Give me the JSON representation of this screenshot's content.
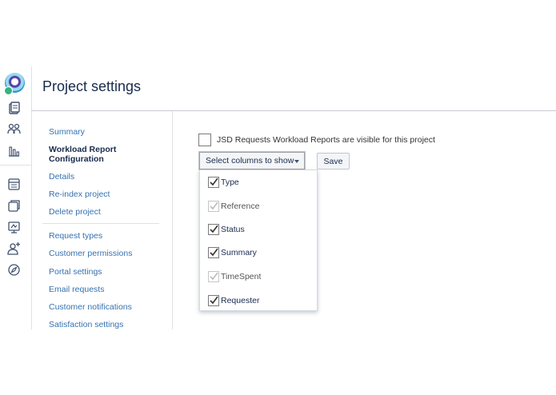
{
  "page": {
    "title": "Project settings"
  },
  "sidebar_nav": {
    "group1": [
      {
        "label": "Summary",
        "active": false
      },
      {
        "label": "Workload Report",
        "active": true
      },
      {
        "label": "Configuration",
        "active": true
      },
      {
        "label": "Details",
        "active": false
      },
      {
        "label": "Re-index project",
        "active": false
      },
      {
        "label": "Delete project",
        "active": false
      }
    ],
    "group2": [
      {
        "label": "Request types"
      },
      {
        "label": "Customer permissions"
      },
      {
        "label": "Portal settings"
      },
      {
        "label": "Email requests"
      },
      {
        "label": "Customer notifications"
      },
      {
        "label": "Satisfaction settings"
      }
    ]
  },
  "visibility": {
    "label": "JSD Requests Workload Reports are visible for this project",
    "checked": false
  },
  "controls": {
    "select_columns_label": "Select columns to show",
    "save_label": "Save"
  },
  "columns_menu": [
    {
      "label": "Type",
      "checked": true,
      "disabled": false
    },
    {
      "label": "Reference",
      "checked": true,
      "disabled": true
    },
    {
      "label": "Status",
      "checked": true,
      "disabled": false
    },
    {
      "label": "Summary",
      "checked": true,
      "disabled": false
    },
    {
      "label": "TimeSpent",
      "checked": true,
      "disabled": true
    },
    {
      "label": "Requester",
      "checked": true,
      "disabled": false
    }
  ],
  "icons": [
    "app-logo-icon",
    "board-icon",
    "queues-icon",
    "reports-icon",
    "knowledge-base-icon",
    "pages-icon",
    "add-shortcut-icon",
    "invite-team-icon",
    "project-settings-icon"
  ],
  "colors": {
    "link": "#3572b0",
    "text": "#172b4d",
    "checkmark": "#333333",
    "checkmark_disabled": "#b3b3b3"
  }
}
